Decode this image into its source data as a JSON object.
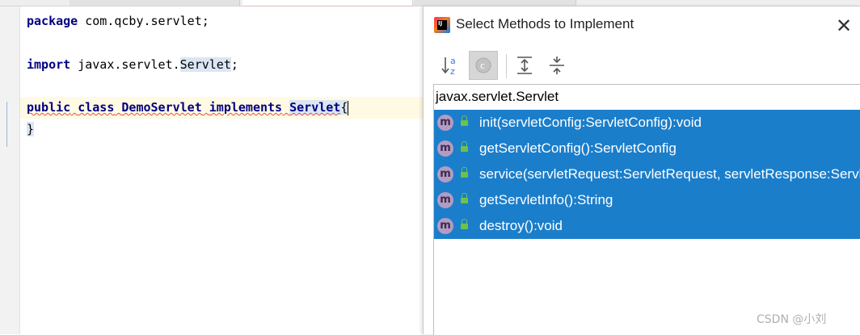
{
  "editor": {
    "lines": [
      {
        "keyword": "package",
        "rest": " com.qcby.servlet;"
      },
      {
        "keyword": "import",
        "rest_a": " javax.servlet.",
        "highlight": "Servlet",
        "rest_b": ";"
      },
      {
        "kw1": "public",
        "kw2": "class",
        "class_name": "DemoServlet",
        "kw3": "implements",
        "iface": "Servlet",
        "brace": "{"
      },
      {
        "brace": "}"
      }
    ]
  },
  "dialog": {
    "title": "Select Methods to Implement",
    "close_label": "✕",
    "app_icon_text": "IJ",
    "toolbar": {
      "sort_icon": "sort-alpha-icon",
      "toggle_icon": "show-classes-icon",
      "expand_icon": "expand-all-icon",
      "collapse_icon": "collapse-all-icon"
    },
    "group": "javax.servlet.Servlet",
    "methods": [
      "init(servletConfig:ServletConfig):void",
      "getServletConfig():ServletConfig",
      "service(servletRequest:ServletRequest, servletResponse:ServletResponse):void",
      "getServletInfo():String",
      "destroy():void"
    ],
    "method_icon_letter": "m",
    "colors": {
      "selection": "#1b7ecb",
      "method_icon": "#b39cc4",
      "lock": "#6cc24a"
    }
  },
  "watermark": "CSDN @小刘"
}
